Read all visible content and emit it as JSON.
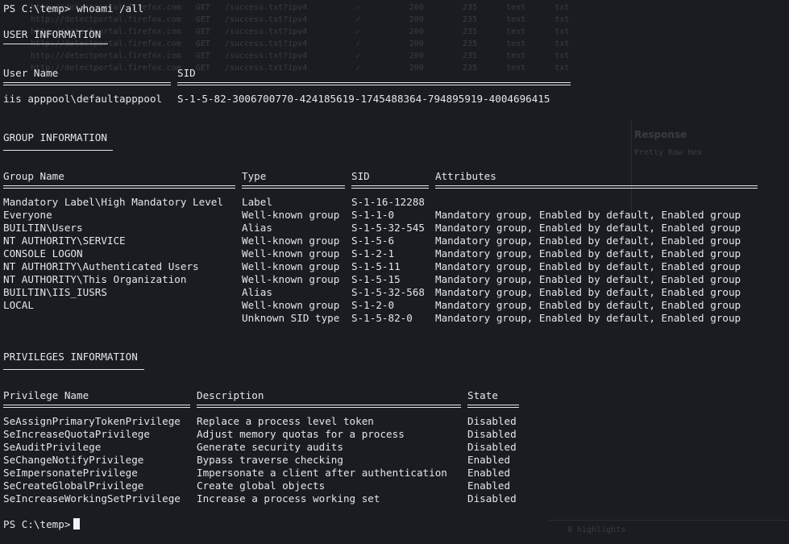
{
  "terminal": {
    "prompt_command": "PS C:\\temp> whoami /all",
    "final_prompt": "PS C:\\temp>",
    "user_section": {
      "title": "USER INFORMATION",
      "headers": [
        "User Name",
        "SID"
      ],
      "rows": [
        [
          "iis apppool\\defaultapppool",
          "S-1-5-82-3006700770-424185619-1745488364-794895919-4004696415"
        ]
      ]
    },
    "group_section": {
      "title": "GROUP INFORMATION",
      "headers": [
        "Group Name",
        "Type",
        "SID",
        "Attributes"
      ],
      "rows": [
        [
          "Mandatory Label\\High Mandatory Level",
          "Label",
          "S-1-16-12288",
          ""
        ],
        [
          "Everyone",
          "Well-known group",
          "S-1-1-0",
          "Mandatory group, Enabled by default, Enabled group"
        ],
        [
          "BUILTIN\\Users",
          "Alias",
          "S-1-5-32-545",
          "Mandatory group, Enabled by default, Enabled group"
        ],
        [
          "NT AUTHORITY\\SERVICE",
          "Well-known group",
          "S-1-5-6",
          "Mandatory group, Enabled by default, Enabled group"
        ],
        [
          "CONSOLE LOGON",
          "Well-known group",
          "S-1-2-1",
          "Mandatory group, Enabled by default, Enabled group"
        ],
        [
          "NT AUTHORITY\\Authenticated Users",
          "Well-known group",
          "S-1-5-11",
          "Mandatory group, Enabled by default, Enabled group"
        ],
        [
          "NT AUTHORITY\\This Organization",
          "Well-known group",
          "S-1-5-15",
          "Mandatory group, Enabled by default, Enabled group"
        ],
        [
          "BUILTIN\\IIS_IUSRS",
          "Alias",
          "S-1-5-32-568",
          "Mandatory group, Enabled by default, Enabled group"
        ],
        [
          "LOCAL",
          "Well-known group",
          "S-1-2-0",
          "Mandatory group, Enabled by default, Enabled group"
        ],
        [
          "",
          "Unknown SID type",
          "S-1-5-82-0",
          "Mandatory group, Enabled by default, Enabled group"
        ]
      ]
    },
    "priv_section": {
      "title": "PRIVILEGES INFORMATION",
      "headers": [
        "Privilege Name",
        "Description",
        "State"
      ],
      "rows": [
        [
          "SeAssignPrimaryTokenPrivilege",
          "Replace a process level token",
          "Disabled"
        ],
        [
          "SeIncreaseQuotaPrivilege",
          "Adjust memory quotas for a process",
          "Disabled"
        ],
        [
          "SeAuditPrivilege",
          "Generate security audits",
          "Disabled"
        ],
        [
          "SeChangeNotifyPrivilege",
          "Bypass traverse checking",
          "Enabled"
        ],
        [
          "SeImpersonatePrivilege",
          "Impersonate a client after authentication",
          "Enabled"
        ],
        [
          "SeCreateGlobalPrivilege",
          "Create global objects",
          "Enabled"
        ],
        [
          "SeIncreaseWorkingSetPrivilege",
          "Increase a process working set",
          "Disabled"
        ]
      ]
    }
  },
  "background": {
    "response_title": "Response",
    "response_tabs": "Pretty   Raw   Hex",
    "highlights_label": "0 highlights",
    "request_rows": [
      "     http://detectportal.firefox.com   GET   /success.txt?ipv4          ✓          200        235      text      txt",
      "     http://detectportal.firefox.com   GET   /success.txt?ipv4          ✓          200        235      text      txt",
      "     http://detectportal.firefox.com   GET   /success.txt?ipv4          ✓          200        235      text      txt",
      "     http://detectportal.firefox.com   GET   /success.txt?ipv4          ✓          200        235      text      txt",
      "     http://detectportal.firefox.com   GET   /success.txt?ipv4          ✓          200        235      text      txt",
      "     http://detectportal.firefox.com   GET   /success.txt?ipv4          ✓          200        235      text      txt"
    ]
  }
}
